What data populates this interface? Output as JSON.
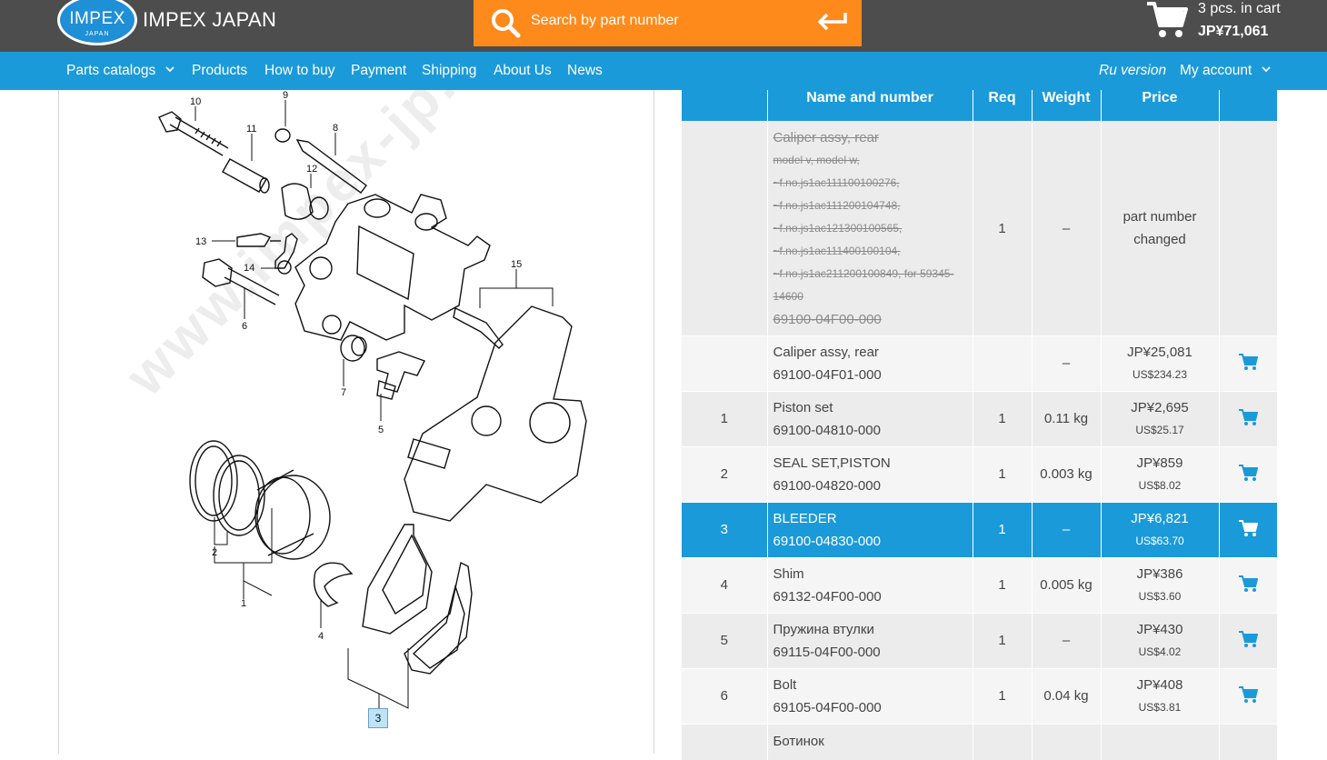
{
  "header": {
    "logo_main": "IMPEX",
    "logo_sub": "JAPAN",
    "brand": "IMPEX JAPAN",
    "search_placeholder": "Search by part number",
    "cart_count": "3 pcs. in cart",
    "cart_total": "JP¥71,061"
  },
  "nav": {
    "items": [
      "Parts catalogs",
      "Products",
      "How to buy",
      "Payment",
      "Shipping",
      "About Us",
      "News"
    ],
    "ru_version": "Ru version",
    "my_account": "My account"
  },
  "diagram": {
    "watermark": "www.impex-jp.com",
    "callouts": [
      "10",
      "9",
      "11",
      "8",
      "12",
      "13",
      "14",
      "6",
      "15",
      "7",
      "5",
      "2",
      "1",
      "4",
      "3"
    ]
  },
  "table": {
    "headers": [
      "",
      "Name and number",
      "Req",
      "Weight",
      "Price",
      ""
    ],
    "obsolete": {
      "name": "Caliper assy, rear",
      "notes": [
        "model v, model w,",
        "~f.no.js1ac111100100276,",
        "~f.no.js1ac111200104748,",
        "~f.no.js1ac121300100565,",
        "~f.no.js1ac111400100104,",
        "~f.no.js1ac211200100849, for 59345-",
        "14600"
      ],
      "number": "69100-04F00-000",
      "req": "1",
      "weight": "–",
      "status_line1": "part number",
      "status_line2": "changed"
    },
    "rows": [
      {
        "num": "",
        "name": "Caliper assy, rear",
        "part": "69100-04F01-000",
        "req": "",
        "weight": "–",
        "jpy": "JP¥25,081",
        "usd": "US$234.23"
      },
      {
        "num": "1",
        "name": "Piston set",
        "part": "69100-04810-000",
        "req": "1",
        "weight": "0.11 kg",
        "jpy": "JP¥2,695",
        "usd": "US$25.17"
      },
      {
        "num": "2",
        "name": "SEAL SET,PISTON",
        "part": "69100-04820-000",
        "req": "1",
        "weight": "0.003 kg",
        "jpy": "JP¥859",
        "usd": "US$8.02"
      },
      {
        "num": "3",
        "name": "BLEEDER",
        "part": "69100-04830-000",
        "req": "1",
        "weight": "–",
        "jpy": "JP¥6,821",
        "usd": "US$63.70"
      },
      {
        "num": "4",
        "name": "Shim",
        "part": "69132-04F00-000",
        "req": "1",
        "weight": "0.005 kg",
        "jpy": "JP¥386",
        "usd": "US$3.60"
      },
      {
        "num": "5",
        "name": "Пружина втулки",
        "part": "69115-04F00-000",
        "req": "1",
        "weight": "–",
        "jpy": "JP¥430",
        "usd": "US$4.02"
      },
      {
        "num": "6",
        "name": "Bolt",
        "part": "69105-04F00-000",
        "req": "1",
        "weight": "0.04 kg",
        "jpy": "JP¥408",
        "usd": "US$3.81"
      },
      {
        "num": "",
        "name": "Ботинок",
        "part": "",
        "req": "",
        "weight": "",
        "jpy": "",
        "usd": ""
      }
    ]
  },
  "colors": {
    "topbar": "#4d4d4d",
    "accent_blue": "#1b9ad9",
    "search_orange": "#ff8a1c"
  }
}
